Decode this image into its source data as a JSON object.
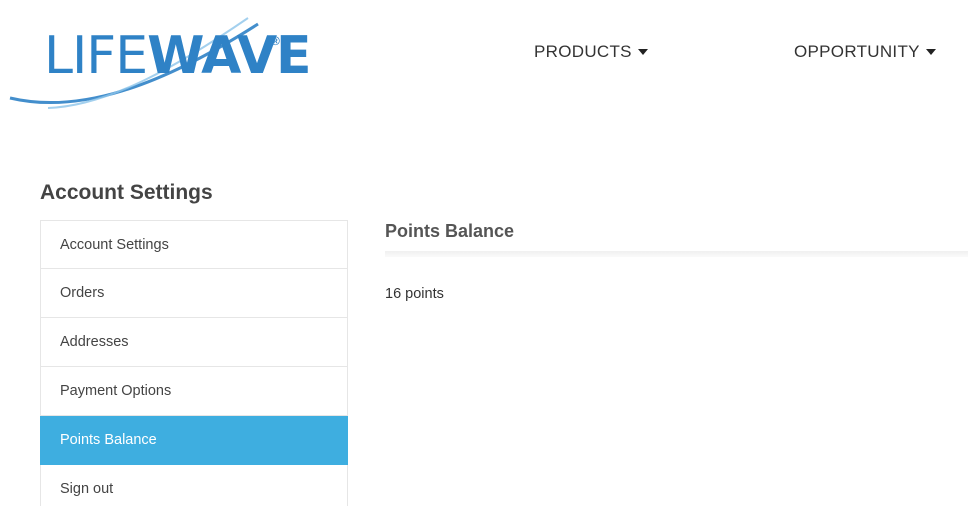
{
  "brand": {
    "logo_light": "LIFE",
    "logo_bold": "WAVE",
    "logo_mark": "®",
    "accent_color": "#2f82c6"
  },
  "nav": {
    "products_label": "PRODUCTS",
    "opportunity_label": "OPPORTUNITY"
  },
  "section": {
    "title": "Account Settings"
  },
  "sidebar": {
    "active_color": "#3eaee0",
    "items": [
      {
        "label": "Account Settings"
      },
      {
        "label": "Orders"
      },
      {
        "label": "Addresses"
      },
      {
        "label": "Payment Options"
      },
      {
        "label": "Points Balance"
      },
      {
        "label": "Sign out"
      }
    ],
    "active_item": "Points Balance"
  },
  "content": {
    "title": "Points Balance",
    "value": "16 points"
  }
}
